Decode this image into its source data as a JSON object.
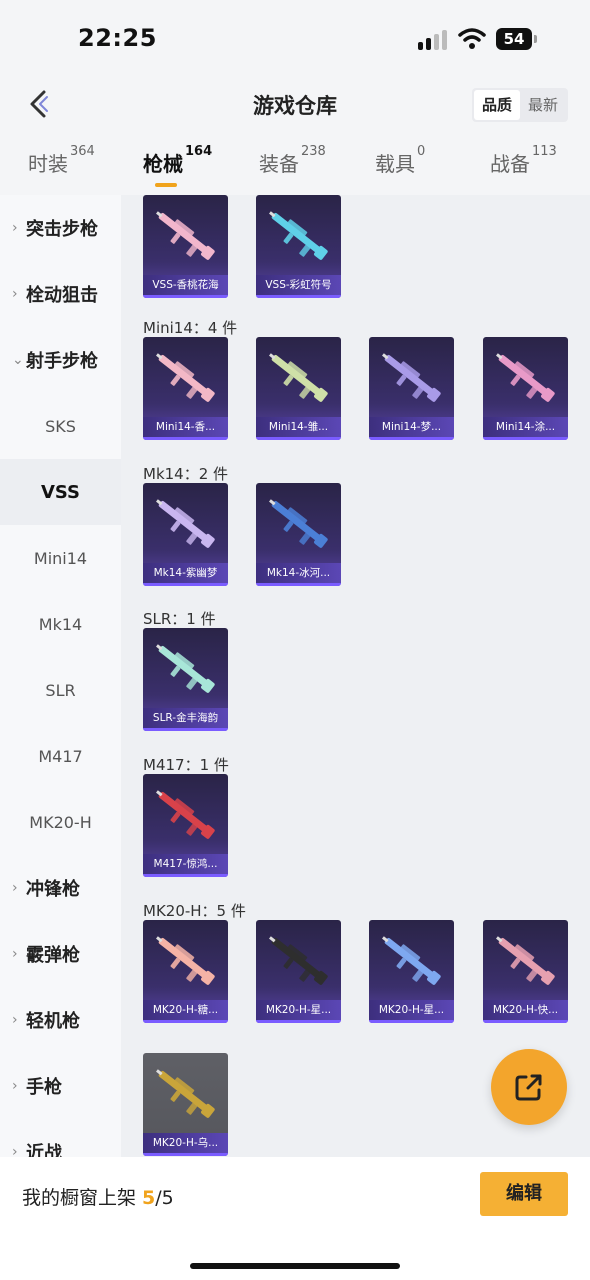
{
  "status_bar": {
    "time": "22:25",
    "battery": "54"
  },
  "header": {
    "title": "游戏仓库",
    "sort_options": [
      "品质",
      "最新"
    ]
  },
  "tabs": [
    {
      "label": "时装",
      "count": "364"
    },
    {
      "label": "枪械",
      "count": "164"
    },
    {
      "label": "装备",
      "count": "238"
    },
    {
      "label": "载具",
      "count": "0"
    },
    {
      "label": "战备",
      "count": "113"
    }
  ],
  "sidebar": {
    "items": [
      {
        "label": "突击步枪",
        "group": true,
        "expanded": false
      },
      {
        "label": "栓动狙击",
        "group": true,
        "expanded": false
      },
      {
        "label": "射手步枪",
        "group": true,
        "expanded": true
      },
      {
        "label": "SKS",
        "group": false
      },
      {
        "label": "VSS",
        "group": false,
        "active": true
      },
      {
        "label": "Mini14",
        "group": false
      },
      {
        "label": "Mk14",
        "group": false
      },
      {
        "label": "SLR",
        "group": false
      },
      {
        "label": "M417",
        "group": false
      },
      {
        "label": "MK20-H",
        "group": false
      },
      {
        "label": "冲锋枪",
        "group": true,
        "expanded": false
      },
      {
        "label": "霰弹枪",
        "group": true,
        "expanded": false
      },
      {
        "label": "轻机枪",
        "group": true,
        "expanded": false
      },
      {
        "label": "手枪",
        "group": true,
        "expanded": false
      },
      {
        "label": "近战",
        "group": true,
        "expanded": false
      }
    ]
  },
  "sections": [
    {
      "label": "",
      "items": [
        {
          "name": "VSS-香桃花海",
          "color": "#f2b6cc"
        },
        {
          "name": "VSS-彩虹符号",
          "color": "#5fd0e8"
        }
      ]
    },
    {
      "label": "Mini14：4 件",
      "items": [
        {
          "name": "Mini14-香...",
          "color": "#f3b8c6"
        },
        {
          "name": "Mini14-雏...",
          "color": "#cfe0a8"
        },
        {
          "name": "Mini14-梦...",
          "color": "#a99be8"
        },
        {
          "name": "Mini14-涂...",
          "color": "#e89ac8"
        }
      ]
    },
    {
      "label": "Mk14：2 件",
      "items": [
        {
          "name": "Mk14-紫幽梦",
          "color": "#c9b6f0"
        },
        {
          "name": "Mk14-冰河...",
          "color": "#4b7fd6"
        }
      ]
    },
    {
      "label": "SLR：1 件",
      "items": [
        {
          "name": "SLR-金丰海韵",
          "color": "#a8e6d8"
        }
      ]
    },
    {
      "label": "M417：1 件",
      "items": [
        {
          "name": "M417-惊鸿...",
          "color": "#d8424a"
        }
      ]
    },
    {
      "label": "MK20-H：5 件",
      "items": [
        {
          "name": "MK20-H-糖...",
          "color": "#f5b3a6"
        },
        {
          "name": "MK20-H-星...",
          "color": "#2e2e2e"
        },
        {
          "name": "MK20-H-星...",
          "color": "#7ea8f0"
        },
        {
          "name": "MK20-H-快...",
          "color": "#e6a0b0"
        },
        {
          "name": "MK20-H-乌...",
          "color": "#c9a53a",
          "gray": true
        }
      ]
    }
  ],
  "bottom_bar": {
    "label": "我的橱窗上架 ",
    "current": "5",
    "total": "/5",
    "edit_label": "编辑"
  }
}
